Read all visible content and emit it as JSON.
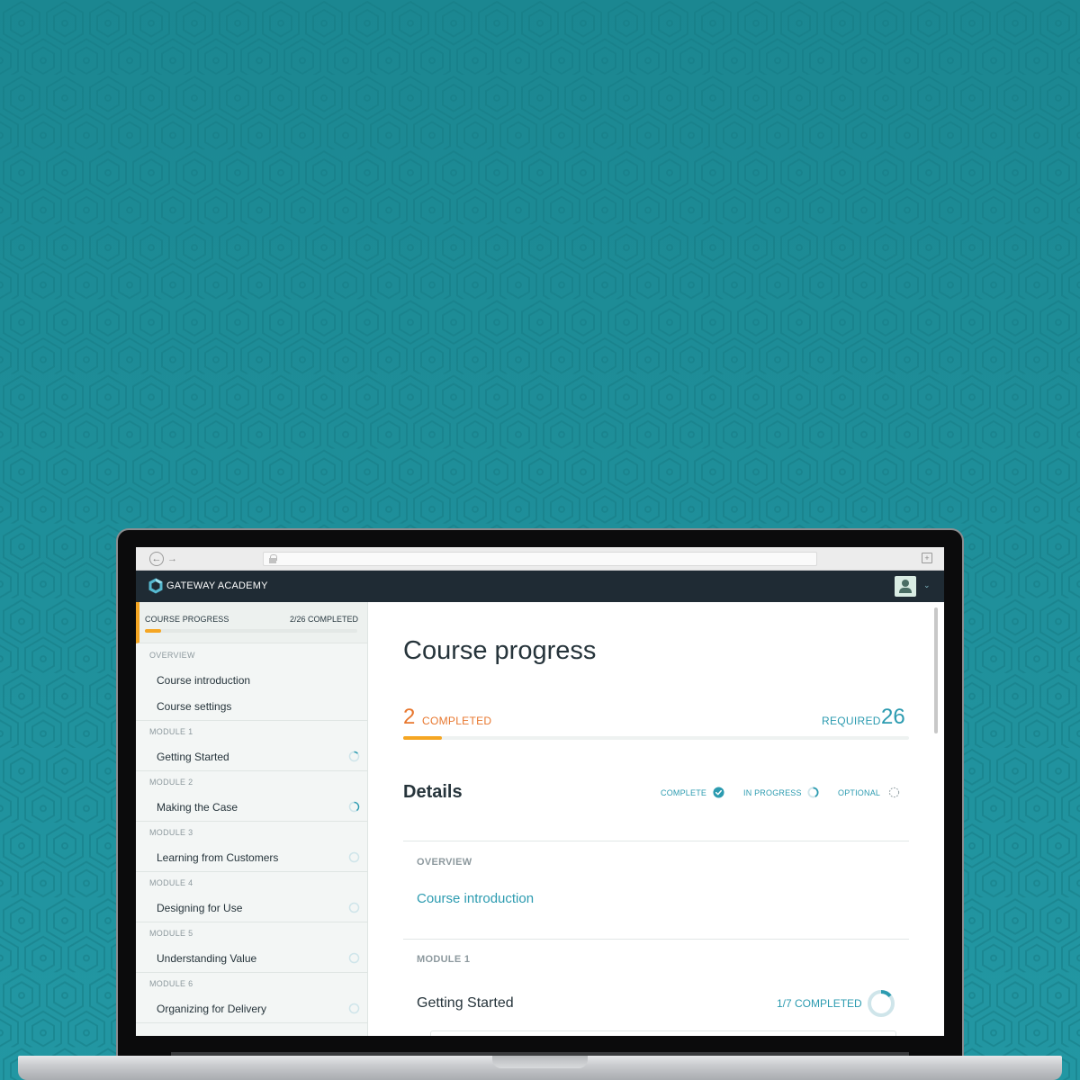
{
  "app": {
    "name": "GATEWAY ACADEMY"
  },
  "browser": {
    "back_icon": "back-arrow-icon",
    "forward_icon": "forward-arrow-icon",
    "lock_icon": "lock-icon",
    "newtab_icon": "new-tab-icon"
  },
  "header": {
    "avatar_icon": "user-avatar-icon",
    "menu_icon": "chevron-down-icon"
  },
  "colors": {
    "background": "#1f8e99",
    "header": "#1f2b34",
    "accent_orange": "#f5a623",
    "completed_orange": "#e8772e",
    "accent_teal": "#2c9bb0",
    "ring_gray": "#cfe5ea"
  },
  "sidebar": {
    "progress_label": "COURSE PROGRESS",
    "progress_count": "2/26 COMPLETED",
    "progress_fraction": 0.0769,
    "sections": [
      {
        "label": "OVERVIEW",
        "items": [
          {
            "label": "Course introduction",
            "status": "none"
          },
          {
            "label": "Course settings",
            "status": "none"
          }
        ]
      },
      {
        "label": "MODULE 1",
        "items": [
          {
            "label": "Getting Started",
            "status": "in-progress",
            "progress": 0.14
          }
        ]
      },
      {
        "label": "MODULE 2",
        "items": [
          {
            "label": "Making the Case",
            "status": "in-progress",
            "progress": 0.4
          }
        ]
      },
      {
        "label": "MODULE 3",
        "items": [
          {
            "label": "Learning from Customers",
            "status": "not-started",
            "progress": 0
          }
        ]
      },
      {
        "label": "MODULE 4",
        "items": [
          {
            "label": "Designing for Use",
            "status": "not-started",
            "progress": 0
          }
        ]
      },
      {
        "label": "MODULE 5",
        "items": [
          {
            "label": "Understanding Value",
            "status": "not-started",
            "progress": 0
          }
        ]
      },
      {
        "label": "MODULE 6",
        "items": [
          {
            "label": "Organizing for Delivery",
            "status": "not-started",
            "progress": 0
          }
        ]
      }
    ]
  },
  "main": {
    "title": "Course progress",
    "completed_count": "2",
    "completed_label": "COMPLETED",
    "required_label": "REQUIRED",
    "required_count": "26",
    "progress_fraction": 0.0769,
    "details_title": "Details",
    "legend": [
      {
        "label": "COMPLETE",
        "icon": "check-circle-icon"
      },
      {
        "label": "IN PROGRESS",
        "icon": "progress-ring-icon"
      },
      {
        "label": "OPTIONAL",
        "icon": "dashed-circle-icon"
      }
    ],
    "overview": {
      "section_label": "OVERVIEW",
      "link": "Course introduction"
    },
    "module1": {
      "section_label": "MODULE 1",
      "title": "Getting Started",
      "count": "1/7 COMPLETED",
      "progress": 0.14
    }
  }
}
